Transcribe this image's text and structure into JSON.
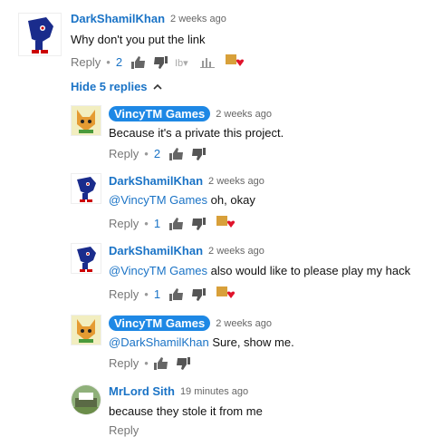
{
  "comments": [
    {
      "author": "DarkShamilKhan",
      "time": "2 weeks ago",
      "text": "Why don't you put the link",
      "reply": "Reply",
      "likes": "2"
    },
    {
      "author": "VincyTM Games",
      "time": "2 weeks ago",
      "text": "Because it's a private this project.",
      "reply": "Reply",
      "likes": "2"
    },
    {
      "author": "DarkShamilKhan",
      "time": "2 weeks ago",
      "mention": "@VincyTM Games",
      "text": "oh, okay",
      "reply": "Reply",
      "likes": "1"
    },
    {
      "author": "DarkShamilKhan",
      "time": "2 weeks ago",
      "mention": "@VincyTM Games",
      "text": "also would like to please play my hack",
      "reply": "Reply",
      "likes": "1"
    },
    {
      "author": "VincyTM Games",
      "time": "2 weeks ago",
      "mention": "@DarkShamilKhan",
      "text": "Sure, show me.",
      "reply": "Reply"
    },
    {
      "author": "MrLord Sith",
      "time": "19 minutes ago",
      "text": "because they stole it from me",
      "reply": "Reply"
    }
  ],
  "thread": {
    "hide_replies_label": "Hide 5 replies"
  },
  "colors": {
    "link": "#1a73c6",
    "owner_badge": "#1e88e5",
    "heart": "#e0132b"
  }
}
